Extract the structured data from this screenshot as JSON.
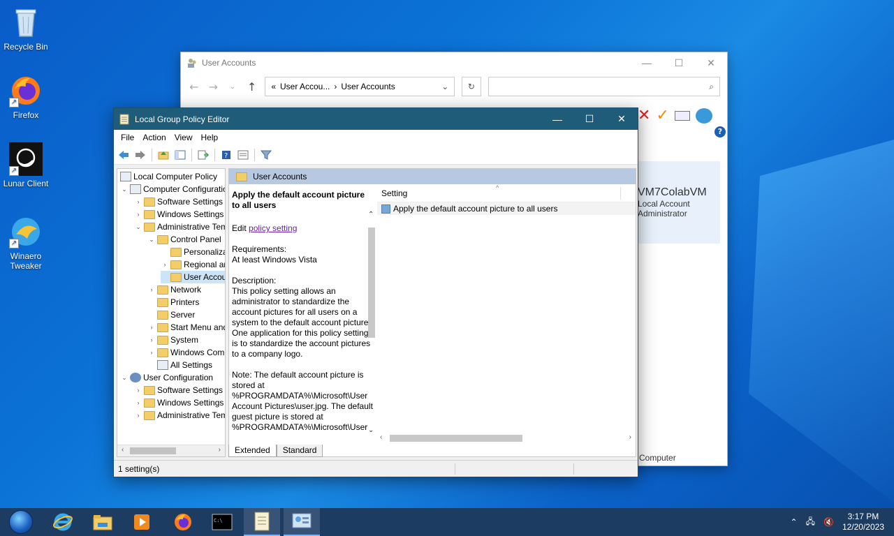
{
  "desktop": {
    "icons": [
      {
        "label": "Recycle Bin"
      },
      {
        "label": "Firefox"
      },
      {
        "label": "Lunar Client"
      },
      {
        "label": "Winaero Tweaker"
      }
    ]
  },
  "ua_window": {
    "title": "User Accounts",
    "address": {
      "part1": "User Accou...",
      "part2": "User Accounts"
    },
    "card": {
      "username": "VM7ColabVM",
      "type_line1": "Local Account",
      "type_line2": "Administrator"
    },
    "footer": "Computer"
  },
  "gpe": {
    "title": "Local Group Policy Editor",
    "menu": {
      "file": "File",
      "action": "Action",
      "view": "View",
      "help": "Help"
    },
    "tree": [
      {
        "label": "Local Computer Policy"
      },
      {
        "label": "Computer Configuration"
      },
      {
        "label": "Software Settings"
      },
      {
        "label": "Windows Settings"
      },
      {
        "label": "Administrative Templates"
      },
      {
        "label": "Control Panel"
      },
      {
        "label": "Personalization"
      },
      {
        "label": "Regional and Language Options"
      },
      {
        "label": "User Accounts"
      },
      {
        "label": "Network"
      },
      {
        "label": "Printers"
      },
      {
        "label": "Server"
      },
      {
        "label": "Start Menu and Taskbar"
      },
      {
        "label": "System"
      },
      {
        "label": "Windows Components"
      },
      {
        "label": "All Settings"
      },
      {
        "label": "User Configuration"
      },
      {
        "label": "Software Settings"
      },
      {
        "label": "Windows Settings"
      },
      {
        "label": "Administrative Templates"
      }
    ],
    "pane_header": "User Accounts",
    "description": {
      "title": "Apply the default account picture to all users",
      "edit_prefix": "Edit ",
      "edit_link": "policy setting ",
      "requirements_label": "Requirements:",
      "requirements_value": "At least Windows Vista",
      "description_label": "Description:",
      "description_text": "This policy setting allows an administrator to standardize the account pictures for all users on a system to the default account picture. One application for this policy setting is to standardize the account pictures to a company logo.",
      "note_text": "Note: The default account picture is stored at %PROGRAMDATA%\\Microsoft\\User Account Pictures\\user.jpg. The default guest picture is stored at %PROGRAMDATA%\\Microsoft\\User"
    },
    "list": {
      "column_header": "Setting",
      "rows": [
        "Apply the default account picture to all users"
      ]
    },
    "tabs": {
      "extended": "Extended",
      "standard": "Standard"
    },
    "status": "1 setting(s)"
  },
  "taskbar": {
    "time": "3:17 PM",
    "date": "12/20/2023"
  }
}
